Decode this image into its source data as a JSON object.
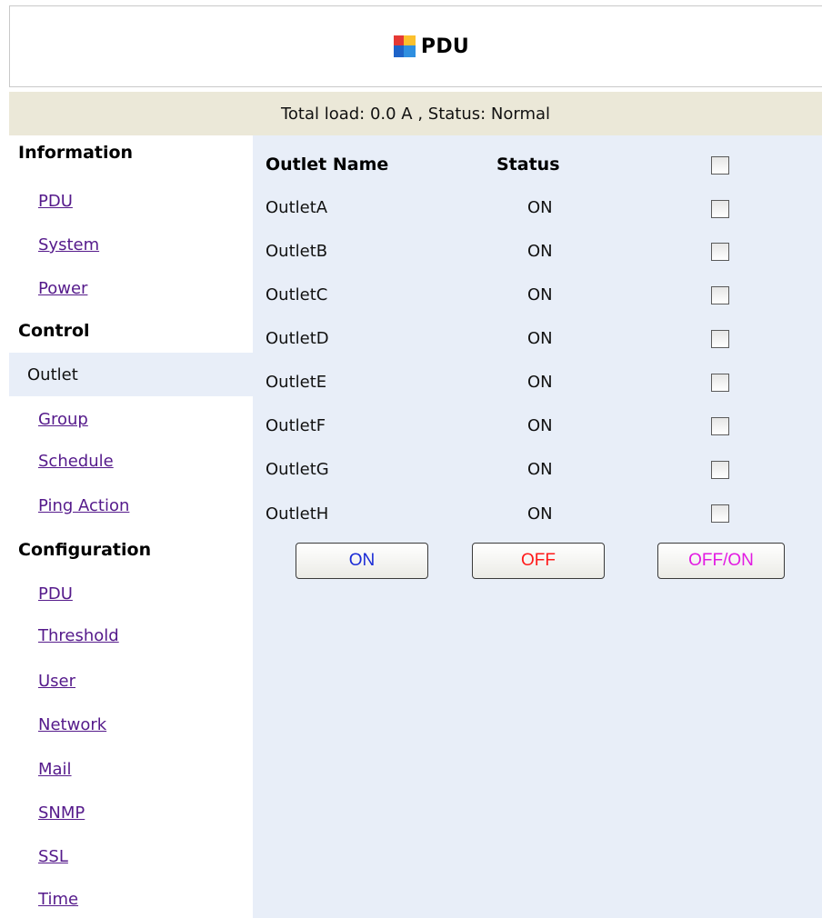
{
  "header": {
    "title": "PDU",
    "icon": "app-tile-icon"
  },
  "status_bar": {
    "text": "Total load: 0.0 A , Status: Normal"
  },
  "sidebar": {
    "sections": [
      {
        "heading": "Information",
        "items": [
          {
            "label": "PDU",
            "active": false
          },
          {
            "label": "System",
            "active": false
          },
          {
            "label": "Power",
            "active": false
          }
        ]
      },
      {
        "heading": "Control",
        "items": [
          {
            "label": "Outlet",
            "active": true
          },
          {
            "label": "Group",
            "active": false
          },
          {
            "label": "Schedule",
            "active": false
          },
          {
            "label": "Ping Action",
            "active": false
          }
        ]
      },
      {
        "heading": "Configuration",
        "items": [
          {
            "label": "PDU",
            "active": false
          },
          {
            "label": "Threshold",
            "active": false
          },
          {
            "label": "User",
            "active": false
          },
          {
            "label": "Network",
            "active": false
          },
          {
            "label": "Mail",
            "active": false
          },
          {
            "label": "SNMP",
            "active": false
          },
          {
            "label": "SSL",
            "active": false
          },
          {
            "label": "Time",
            "active": false
          }
        ]
      }
    ]
  },
  "outlets": {
    "columns": {
      "name": "Outlet Name",
      "status": "Status"
    },
    "select_all_checked": false,
    "rows": [
      {
        "name": "OutletA",
        "status": "ON",
        "checked": false
      },
      {
        "name": "OutletB",
        "status": "ON",
        "checked": false
      },
      {
        "name": "OutletC",
        "status": "ON",
        "checked": false
      },
      {
        "name": "OutletD",
        "status": "ON",
        "checked": false
      },
      {
        "name": "OutletE",
        "status": "ON",
        "checked": false
      },
      {
        "name": "OutletF",
        "status": "ON",
        "checked": false
      },
      {
        "name": "OutletG",
        "status": "ON",
        "checked": false
      },
      {
        "name": "OutletH",
        "status": "ON",
        "checked": false
      }
    ],
    "buttons": {
      "on": {
        "label": "ON",
        "color": "#1a2bd6"
      },
      "off": {
        "label": "OFF",
        "color": "#ff1a1a"
      },
      "offon": {
        "label": "OFF/ON",
        "color": "#e21ae2"
      }
    }
  },
  "colors": {
    "status_bar_bg": "#ebe8d8",
    "content_bg": "#e8eef8",
    "active_nav_bg": "#e8eef8",
    "link": "#551a8b"
  }
}
